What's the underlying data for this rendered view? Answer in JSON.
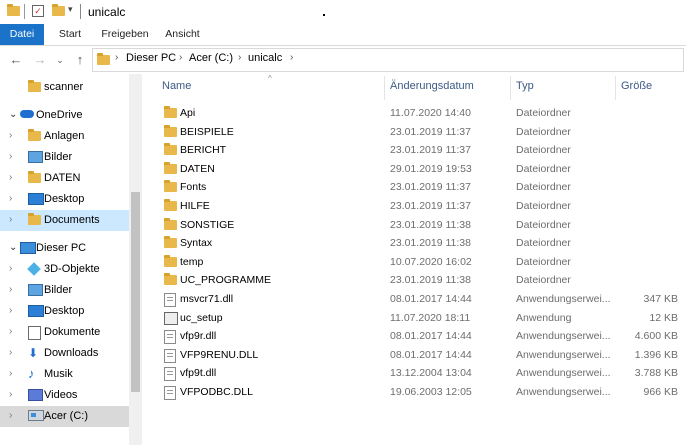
{
  "window": {
    "title": "unicalc"
  },
  "ribbon": {
    "tabs": [
      "Datei",
      "Start",
      "Freigeben",
      "Ansicht"
    ],
    "active_index": 0
  },
  "address": {
    "crumbs": [
      "Dieser PC",
      "Acer (C:)",
      "unicalc"
    ]
  },
  "nav": {
    "items": [
      {
        "label": "scanner",
        "icon": "folder-icon",
        "indent": 1,
        "chevron": ""
      },
      {
        "label": "OneDrive",
        "icon": "cloud-icon",
        "indent": 0,
        "chevron": "down"
      },
      {
        "label": "Anlagen",
        "icon": "folder-icon",
        "indent": 1,
        "chevron": "right"
      },
      {
        "label": "Bilder",
        "icon": "pictures-icon",
        "indent": 1,
        "chevron": "right"
      },
      {
        "label": "DATEN",
        "icon": "folder-icon",
        "indent": 1,
        "chevron": "right"
      },
      {
        "label": "Desktop",
        "icon": "desktop-icon",
        "indent": 1,
        "chevron": "right"
      },
      {
        "label": "Documents",
        "icon": "folder-icon",
        "indent": 1,
        "chevron": "right",
        "selected": true
      },
      {
        "label": "Dieser PC",
        "icon": "pc-icon",
        "indent": 0,
        "chevron": "down"
      },
      {
        "label": "3D-Objekte",
        "icon": "cube-icon",
        "indent": 1,
        "chevron": "right"
      },
      {
        "label": "Bilder",
        "icon": "pictures-icon",
        "indent": 1,
        "chevron": "right"
      },
      {
        "label": "Desktop",
        "icon": "desktop-icon",
        "indent": 1,
        "chevron": "right"
      },
      {
        "label": "Dokumente",
        "icon": "document-icon",
        "indent": 1,
        "chevron": "right"
      },
      {
        "label": "Downloads",
        "icon": "download-icon",
        "indent": 1,
        "chevron": "right"
      },
      {
        "label": "Musik",
        "icon": "music-icon",
        "indent": 1,
        "chevron": "right"
      },
      {
        "label": "Videos",
        "icon": "video-icon",
        "indent": 1,
        "chevron": "right"
      },
      {
        "label": "Acer (C:)",
        "icon": "drive-icon",
        "indent": 1,
        "chevron": "right",
        "highlighted": true
      }
    ]
  },
  "columns": {
    "name": "Name",
    "date": "Änderungsdatum",
    "type": "Typ",
    "size": "Größe"
  },
  "files": [
    {
      "name": "Api",
      "date": "11.07.2020 14:40",
      "type": "Dateiordner",
      "size": "",
      "icon": "folder"
    },
    {
      "name": "BEISPIELE",
      "date": "23.01.2019 11:37",
      "type": "Dateiordner",
      "size": "",
      "icon": "folder"
    },
    {
      "name": "BERICHT",
      "date": "23.01.2019 11:37",
      "type": "Dateiordner",
      "size": "",
      "icon": "folder"
    },
    {
      "name": "DATEN",
      "date": "29.01.2019 19:53",
      "type": "Dateiordner",
      "size": "",
      "icon": "folder"
    },
    {
      "name": "Fonts",
      "date": "23.01.2019 11:37",
      "type": "Dateiordner",
      "size": "",
      "icon": "folder"
    },
    {
      "name": "HILFE",
      "date": "23.01.2019 11:37",
      "type": "Dateiordner",
      "size": "",
      "icon": "folder"
    },
    {
      "name": "SONSTIGE",
      "date": "23.01.2019 11:38",
      "type": "Dateiordner",
      "size": "",
      "icon": "folder"
    },
    {
      "name": "Syntax",
      "date": "23.01.2019 11:38",
      "type": "Dateiordner",
      "size": "",
      "icon": "folder"
    },
    {
      "name": "temp",
      "date": "10.07.2020 16:02",
      "type": "Dateiordner",
      "size": "",
      "icon": "folder"
    },
    {
      "name": "UC_PROGRAMME",
      "date": "23.01.2019 11:38",
      "type": "Dateiordner",
      "size": "",
      "icon": "folder"
    },
    {
      "name": "msvcr71.dll",
      "date": "08.01.2017 14:44",
      "type": "Anwendungserwei...",
      "size": "347 KB",
      "icon": "dll"
    },
    {
      "name": "uc_setup",
      "date": "11.07.2020 18:11",
      "type": "Anwendung",
      "size": "12 KB",
      "icon": "setup"
    },
    {
      "name": "vfp9r.dll",
      "date": "08.01.2017 14:44",
      "type": "Anwendungserwei...",
      "size": "4.600 KB",
      "icon": "dll"
    },
    {
      "name": "VFP9RENU.DLL",
      "date": "08.01.2017 14:44",
      "type": "Anwendungserwei...",
      "size": "1.396 KB",
      "icon": "dll"
    },
    {
      "name": "vfp9t.dll",
      "date": "13.12.2004 13:04",
      "type": "Anwendungserwei...",
      "size": "3.788 KB",
      "icon": "dll"
    },
    {
      "name": "VFPODBC.DLL",
      "date": "19.06.2003 12:05",
      "type": "Anwendungserwei...",
      "size": "966 KB",
      "icon": "dll"
    }
  ]
}
